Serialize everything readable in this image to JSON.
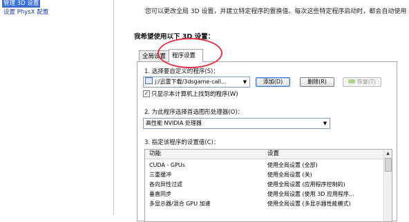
{
  "sidebar": {
    "items": [
      {
        "label": "管理 3D 设置",
        "selected": true
      },
      {
        "label": "设置 PhysX 配置",
        "selected": false
      }
    ]
  },
  "main": {
    "description": "您可以更改全局 3D 设置，并建立特定程序的置换值。每次这些特定程序启动时，都会自动使用",
    "section_title": "我希望使用以下 3D 设置：",
    "tabs": [
      {
        "label": "全局设置",
        "active": false
      },
      {
        "label": "程序设置",
        "active": true
      }
    ],
    "step1": {
      "label": "1. 选择要自定义的程序(S)：",
      "program_value": "j:/迅雷下载/3dsgame-call...",
      "add_button": "添加(D)",
      "delete_button": "删除(R)",
      "restore_button": "恢复(T)",
      "checkbox_label": "只显示本计算机上找到的程序(W)",
      "checkbox_checked": true
    },
    "step2": {
      "label": "2. 为此程序选择首选图形处理器(O)：",
      "value": "高性能 NVIDIA 处理器"
    },
    "step3": {
      "label": "3. 指定该程序的设置值(C)：",
      "columns": [
        "功能",
        "设置"
      ],
      "rows": [
        {
          "feature": "CUDA - GPUs",
          "setting": "使用全局设置 (全部)"
        },
        {
          "feature": "三重缓冲",
          "setting": "使用全局设置 (关)"
        },
        {
          "feature": "各向异性过滤",
          "setting": "使用全局设置 (应用程序控制的)"
        },
        {
          "feature": "垂直同步",
          "setting": "使用全局设置 (使用 3D 应用程序..."
        },
        {
          "feature": "多显示器/混合 GPU 加速",
          "setting": "使用全局设置 (多显示器性能模式)"
        }
      ]
    }
  },
  "colors": {
    "selected_bg": "#3a6fd8",
    "highlight_circle": "#e03545"
  }
}
